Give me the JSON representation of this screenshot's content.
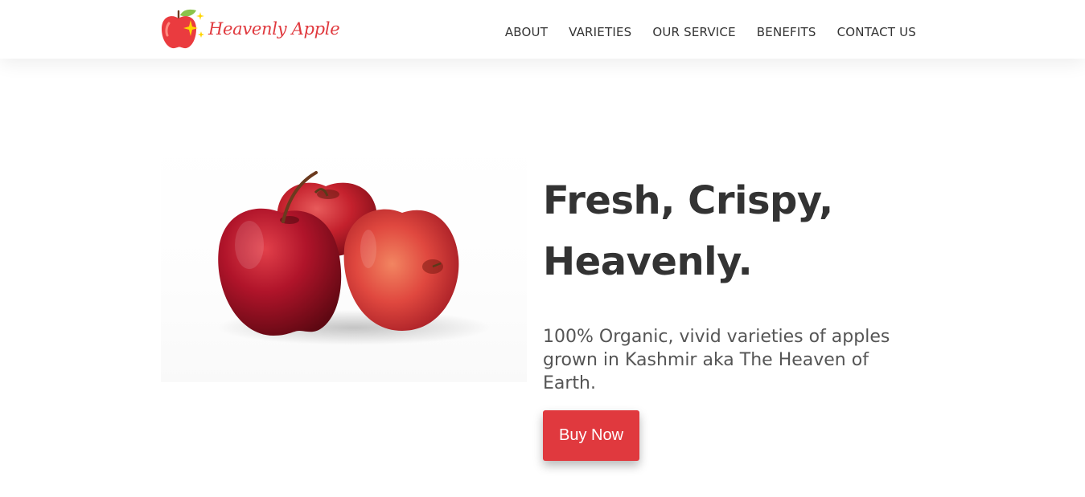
{
  "brand": {
    "name": "Heavenly Apple",
    "logo_icon": "apple-sparkle-icon",
    "accent_color": "#e0393e"
  },
  "nav": {
    "items": [
      {
        "label": "ABOUT"
      },
      {
        "label": "VARIETIES"
      },
      {
        "label": "OUR SERVICE"
      },
      {
        "label": "BENEFITS"
      },
      {
        "label": "CONTACT US"
      }
    ]
  },
  "hero": {
    "headline_line1": "Fresh, Crispy,",
    "headline_line2": "Heavenly.",
    "subtext": "100% Organic, vivid varieties of apples grown in Kashmir aka The Heaven of Earth.",
    "cta_label": "Buy Now",
    "image": "red-apples-image"
  }
}
